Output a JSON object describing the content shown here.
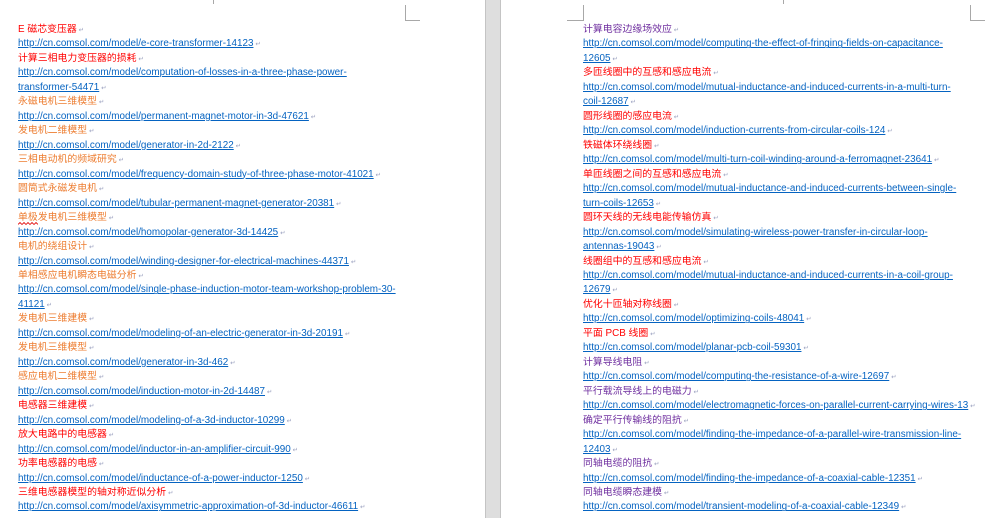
{
  "document": {
    "colors": {
      "red": "#ff0000",
      "orange": "#ed7d31",
      "purple": "#7030a0",
      "link": "#0563c1",
      "paragraph_mark": "#9aa0bf"
    },
    "pages": [
      {
        "entries": [
          {
            "title": "E 磁芯变压器",
            "color": "red",
            "url_lines": [
              "http://cn.comsol.com/model/e-core-transformer-14123"
            ]
          },
          {
            "title": "计算三相电力变压器的损耗",
            "color": "red",
            "url_lines": [
              "http://cn.comsol.com/model/computation-of-losses-in-a-three-phase-power-",
              "transformer-54471"
            ]
          },
          {
            "title": "永磁电机三维模型",
            "color": "orange",
            "url_lines": [
              "http://cn.comsol.com/model/permanent-magnet-motor-in-3d-47621"
            ]
          },
          {
            "title": "发电机二维模型",
            "color": "orange",
            "url_lines": [
              "http://cn.comsol.com/model/generator-in-2d-2122"
            ]
          },
          {
            "title": "三相电动机的频域研究",
            "color": "orange",
            "url_lines": [
              "http://cn.comsol.com/model/frequency-domain-study-of-three-phase-motor-41021"
            ]
          },
          {
            "title": "圆筒式永磁发电机",
            "color": "orange",
            "url_lines": [
              "http://cn.comsol.com/model/tubular-permanent-magnet-generator-20381"
            ]
          },
          {
            "title": "单极发电机三维模型",
            "color": "orange",
            "spellcheck_error": true,
            "url_lines": [
              "http://cn.comsol.com/model/homopolar-generator-3d-14425"
            ]
          },
          {
            "title": "电机的绕组设计",
            "color": "orange",
            "url_lines": [
              "http://cn.comsol.com/model/winding-designer-for-electrical-machines-44371"
            ]
          },
          {
            "title": "单相感应电机瞬态电磁分析",
            "color": "orange",
            "url_lines": [
              "http://cn.comsol.com/model/single-phase-induction-motor-team-workshop-problem-30-",
              "41121"
            ]
          },
          {
            "title": "发电机三维建模",
            "color": "orange",
            "url_lines": [
              "http://cn.comsol.com/model/modeling-of-an-electric-generator-in-3d-20191"
            ]
          },
          {
            "title": "发电机三维模型",
            "color": "orange",
            "url_lines": [
              "http://cn.comsol.com/model/generator-in-3d-462"
            ]
          },
          {
            "title": "感应电机二维模型",
            "color": "orange",
            "url_lines": [
              "http://cn.comsol.com/model/induction-motor-in-2d-14487"
            ]
          },
          {
            "title": "电感器三维建模",
            "color": "red",
            "url_lines": [
              "http://cn.comsol.com/model/modeling-of-a-3d-inductor-10299"
            ]
          },
          {
            "title": "放大电路中的电感器",
            "color": "red",
            "url_lines": [
              "http://cn.comsol.com/model/inductor-in-an-amplifier-circuit-990"
            ]
          },
          {
            "title": "功率电感器的电感",
            "color": "red",
            "url_lines": [
              "http://cn.comsol.com/model/inductance-of-a-power-inductor-1250"
            ]
          },
          {
            "title": "三维电感器模型的轴对称近似分析",
            "color": "red",
            "url_lines": [
              "http://cn.comsol.com/model/axisymmetric-approximation-of-3d-inductor-46611"
            ]
          }
        ]
      },
      {
        "entries": [
          {
            "title": "计算电容边缘场效应",
            "color": "purple",
            "url_lines": [
              "http://cn.comsol.com/model/computing-the-effect-of-fringing-fields-on-capacitance-",
              "12605"
            ]
          },
          {
            "title": "多匝线圈中的互感和感应电流",
            "color": "red",
            "url_lines": [
              "http://cn.comsol.com/model/mutual-inductance-and-induced-currents-in-a-multi-turn-",
              "coil-12687"
            ]
          },
          {
            "title": "圆形线圈的感应电流",
            "color": "red",
            "url_lines": [
              "http://cn.comsol.com/model/induction-currents-from-circular-coils-124"
            ]
          },
          {
            "title": "铁磁体环绕线圈",
            "color": "red",
            "url_lines": [
              "http://cn.comsol.com/model/multi-turn-coil-winding-around-a-ferromagnet-23641"
            ]
          },
          {
            "title": "单匝线圈之间的互感和感应电流",
            "color": "red",
            "url_lines": [
              "http://cn.comsol.com/model/mutual-inductance-and-induced-currents-between-single-",
              "turn-coils-12653"
            ]
          },
          {
            "title": "圆环天线的无线电能传输仿真",
            "color": "red",
            "url_lines": [
              "http://cn.comsol.com/model/simulating-wireless-power-transfer-in-circular-loop-",
              "antennas-19043"
            ]
          },
          {
            "title": "线圈组中的互感和感应电流",
            "color": "red",
            "url_lines": [
              "http://cn.comsol.com/model/mutual-inductance-and-induced-currents-in-a-coil-group-",
              "12679"
            ]
          },
          {
            "title": "优化十匝轴对称线圈",
            "color": "red",
            "url_lines": [
              "http://cn.comsol.com/model/optimizing-coils-48041"
            ]
          },
          {
            "title": "平面 PCB 线圈",
            "color": "red",
            "url_lines": [
              "http://cn.comsol.com/model/planar-pcb-coil-59301"
            ]
          },
          {
            "title": "计算导线电阻",
            "color": "purple",
            "url_lines": [
              "http://cn.comsol.com/model/computing-the-resistance-of-a-wire-12697"
            ]
          },
          {
            "title": "平行载流导线上的电磁力",
            "color": "purple",
            "url_lines": [
              "http://cn.comsol.com/model/electromagnetic-forces-on-parallel-current-carrying-wires-13"
            ]
          },
          {
            "title": "确定平行传输线的阻抗",
            "color": "purple",
            "url_lines": [
              "http://cn.comsol.com/model/finding-the-impedance-of-a-parallel-wire-transmission-line-",
              "12403"
            ]
          },
          {
            "title": "同轴电缆的阻抗",
            "color": "purple",
            "url_lines": [
              "http://cn.comsol.com/model/finding-the-impedance-of-a-coaxial-cable-12351"
            ]
          },
          {
            "title": "同轴电缆瞬态建模",
            "color": "purple",
            "url_lines": [
              "http://cn.comsol.com/model/transient-modeling-of-a-coaxial-cable-12349"
            ]
          }
        ]
      }
    ]
  }
}
